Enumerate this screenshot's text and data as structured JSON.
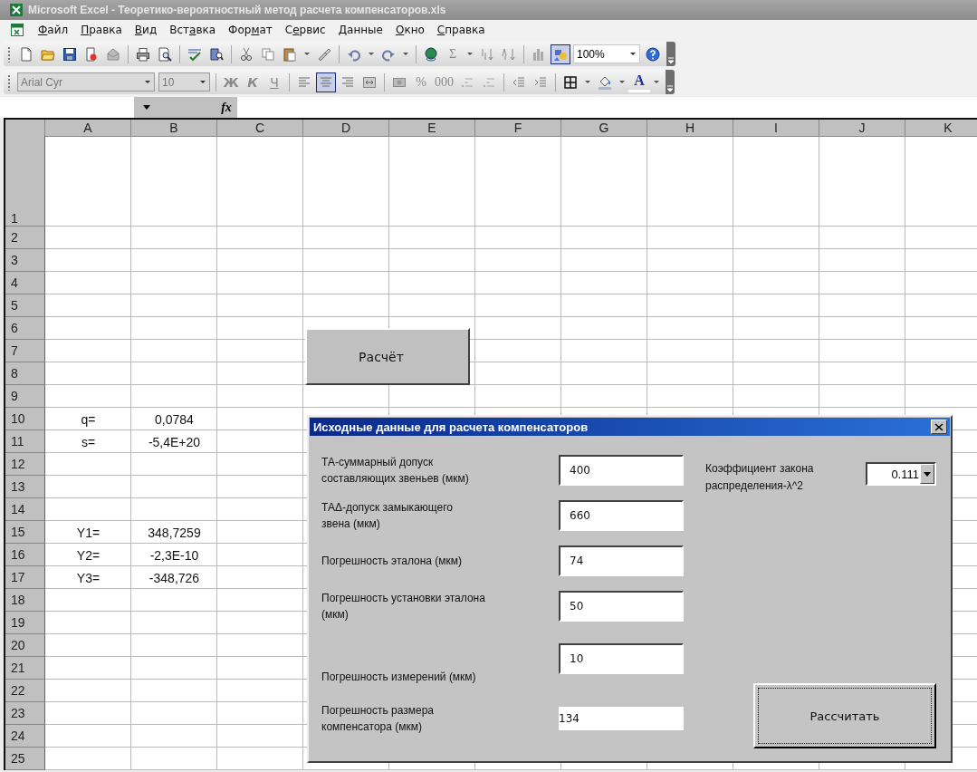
{
  "window": {
    "title": "Microsoft Excel - Теоретико-вероятностный метод расчета компенсаторов.xls",
    "active": false
  },
  "menu": [
    {
      "key": "Ф",
      "post": "айл"
    },
    {
      "key": "П",
      "post": "равка"
    },
    {
      "key": "В",
      "post": "ид"
    },
    {
      "pre": "Вст",
      "key": "а",
      "post": "вка"
    },
    {
      "pre": "Фор",
      "key": "м",
      "post": "ат"
    },
    {
      "pre": "С",
      "key": "е",
      "post": "рвис"
    },
    {
      "key": "Д",
      "post": "анные"
    },
    {
      "key": "О",
      "post": "кно"
    },
    {
      "key": "С",
      "post": "правка"
    }
  ],
  "standard_toolbar": [
    {
      "kind": "icon",
      "pressed": false
    },
    {
      "kind": "icon",
      "pressed": false
    },
    {
      "kind": "icon",
      "pressed": false
    },
    {
      "kind": "icon",
      "pressed": false
    },
    {
      "kind": "icon",
      "pressed": false
    },
    {
      "kind": "separator"
    },
    {
      "kind": "icon",
      "pressed": false
    },
    {
      "kind": "icon",
      "pressed": false
    },
    {
      "kind": "separator"
    },
    {
      "kind": "icon",
      "pressed": false
    },
    {
      "kind": "icon",
      "pressed": false
    },
    {
      "kind": "separator"
    },
    {
      "kind": "icon",
      "pressed": false
    },
    {
      "kind": "icon",
      "pressed": false
    },
    {
      "kind": "icon",
      "pressed": false
    },
    {
      "kind": "caret"
    },
    {
      "kind": "icon",
      "pressed": false
    },
    {
      "kind": "separator"
    },
    {
      "kind": "icon",
      "pressed": false
    },
    {
      "kind": "caret"
    },
    {
      "kind": "icon",
      "pressed": false
    },
    {
      "kind": "caret"
    },
    {
      "kind": "separator"
    },
    {
      "kind": "icon",
      "pressed": false
    },
    {
      "kind": "glyph",
      "text": "Σ",
      "disabled": true,
      "pressed": false
    },
    {
      "kind": "caret"
    },
    {
      "kind": "icon",
      "pressed": false
    },
    {
      "kind": "icon",
      "pressed": false
    },
    {
      "kind": "separator"
    },
    {
      "kind": "icon",
      "pressed": false
    },
    {
      "kind": "icon",
      "pressed": true
    },
    {
      "kind": "combo",
      "value": "100%",
      "disabled": false
    },
    {
      "kind": "icon",
      "pressed": false
    }
  ],
  "formatting_toolbar": [
    {
      "kind": "combo",
      "value": "Arial Cyr",
      "disabled": true
    },
    {
      "kind": "combo",
      "value": "10",
      "disabled": true
    },
    {
      "kind": "separator"
    },
    {
      "kind": "bold",
      "text": "Ж",
      "disabled": true,
      "pressed": false
    },
    {
      "kind": "italic",
      "text": "К",
      "disabled": true,
      "pressed": false
    },
    {
      "kind": "underline",
      "text": "Ч",
      "disabled": true,
      "pressed": false
    },
    {
      "kind": "separator"
    },
    {
      "kind": "icon",
      "pressed": false
    },
    {
      "kind": "icon",
      "pressed": true
    },
    {
      "kind": "icon",
      "pressed": false
    },
    {
      "kind": "icon",
      "pressed": false
    },
    {
      "kind": "separator"
    },
    {
      "kind": "icon",
      "pressed": false
    },
    {
      "kind": "glyph",
      "text": "%",
      "disabled": true,
      "pressed": false
    },
    {
      "kind": "glyph",
      "text": "000",
      "disabled": true,
      "pressed": false
    },
    {
      "kind": "icon",
      "pressed": false
    },
    {
      "kind": "icon",
      "pressed": false
    },
    {
      "kind": "separator"
    },
    {
      "kind": "icon",
      "pressed": false
    },
    {
      "kind": "icon",
      "pressed": false
    },
    {
      "kind": "separator"
    },
    {
      "kind": "icon",
      "pressed": false
    },
    {
      "kind": "caret"
    },
    {
      "kind": "icon",
      "pressed": false
    },
    {
      "kind": "caret"
    },
    {
      "kind": "fontcolor",
      "text": "A",
      "disabled": false,
      "pressed": false
    },
    {
      "kind": "caret"
    }
  ],
  "formula_bar": {
    "function_label": "fx"
  },
  "sheet": {
    "columns": [
      "A",
      "B",
      "C",
      "D",
      "E",
      "F",
      "G",
      "H",
      "I",
      "J",
      "K"
    ],
    "rows": [
      {
        "label": "1",
        "tall": true
      },
      {
        "label": "2"
      },
      {
        "label": "3"
      },
      {
        "label": "4"
      },
      {
        "label": "5"
      },
      {
        "label": "6"
      },
      {
        "label": "7"
      },
      {
        "label": "8"
      },
      {
        "label": "9"
      },
      {
        "label": "10",
        "cells": [
          "q=",
          "0,0784"
        ]
      },
      {
        "label": "11",
        "cells": [
          "s=",
          "-5,4E+20"
        ]
      },
      {
        "label": "12"
      },
      {
        "label": "13"
      },
      {
        "label": "14"
      },
      {
        "label": "15",
        "cells": [
          "Y1=",
          "348,7259"
        ]
      },
      {
        "label": "16",
        "cells": [
          "Y2=",
          "-2,3E-10"
        ]
      },
      {
        "label": "17",
        "cells": [
          "Y3=",
          "-348,726"
        ]
      },
      {
        "label": "18"
      },
      {
        "label": "19"
      },
      {
        "label": "20"
      },
      {
        "label": "21"
      },
      {
        "label": "22"
      },
      {
        "label": "23"
      },
      {
        "label": "24"
      },
      {
        "label": "25"
      }
    ],
    "button": {
      "label": "Расчёт"
    }
  },
  "dialog": {
    "title": "Исходные данные для расчета компенсаторов",
    "fields": [
      {
        "label": "ТА-суммарный допуск составляющих звеньев (мкм)",
        "value": "400",
        "kind": "input"
      },
      {
        "label": "ТАΔ-допуск замыкающего звена (мкм)",
        "value": "660",
        "kind": "input"
      },
      {
        "label": "Погрешность эталона (мкм)",
        "value": "74",
        "kind": "input"
      },
      {
        "label": "Погрешность установки эталона (мкм)",
        "value": "50",
        "kind": "input"
      },
      {
        "label": "Погрешность измерений (мкм)",
        "value": "10",
        "kind": "input"
      },
      {
        "label": "Погрешность размера компенсатора (мкм)",
        "value": "134",
        "kind": "output"
      }
    ],
    "coefficient": {
      "label": "Коэффициент закона распределения-λ^2",
      "value": "0.111"
    },
    "button": {
      "label": "Рассчитать",
      "focused": true
    }
  }
}
